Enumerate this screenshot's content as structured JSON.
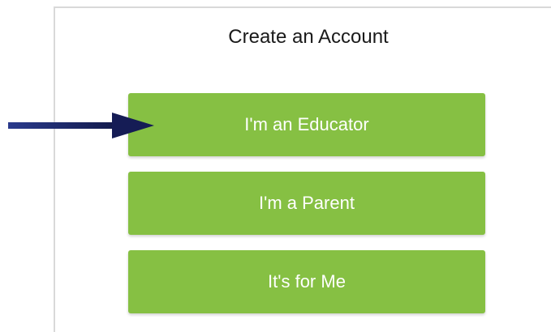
{
  "dialog": {
    "title": "Create an Account"
  },
  "options": [
    {
      "label": "I'm an Educator"
    },
    {
      "label": "I'm a Parent"
    },
    {
      "label": "It's for Me"
    }
  ],
  "colors": {
    "button_bg": "#86c043",
    "button_text": "#ffffff",
    "arrow": "#1c2466"
  },
  "annotation": {
    "icon": "arrow-right-icon",
    "points_to": "I'm an Educator"
  }
}
